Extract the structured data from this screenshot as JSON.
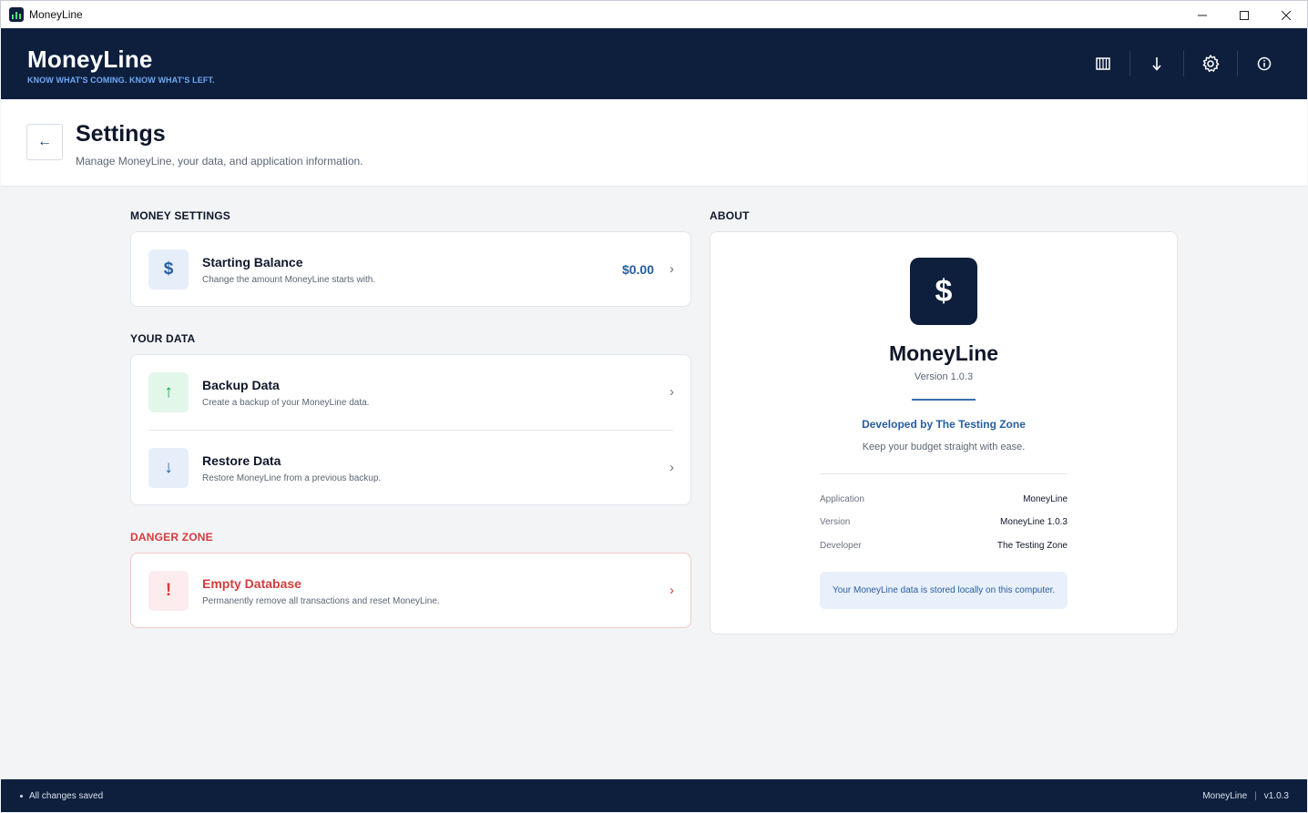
{
  "window": {
    "title": "MoneyLine",
    "controls": {
      "minimize": "—",
      "maximize": "☐",
      "close": "✕"
    }
  },
  "header": {
    "brand": "MoneyLine",
    "tagline": "KNOW WHAT'S COMING. KNOW WHAT'S LEFT.",
    "actions": [
      "calendar-grid-icon",
      "download-icon",
      "gear-icon",
      "info-icon"
    ]
  },
  "page": {
    "back_glyph": "←",
    "title": "Settings",
    "subtitle": "Manage MoneyLine, your data, and application information."
  },
  "money_settings": {
    "label": "MONEY SETTINGS",
    "starting_balance": {
      "icon": "$",
      "title": "Starting Balance",
      "description": "Change the amount MoneyLine starts with.",
      "value": "$0.00",
      "chevron": "›"
    }
  },
  "your_data": {
    "label": "YOUR DATA",
    "backup": {
      "icon": "↑",
      "title": "Backup Data",
      "description": "Create a backup of your MoneyLine data.",
      "chevron": "›"
    },
    "restore": {
      "icon": "↓",
      "title": "Restore Data",
      "description": "Restore MoneyLine from a previous backup.",
      "chevron": "›"
    }
  },
  "danger_zone": {
    "label": "DANGER ZONE",
    "empty_db": {
      "icon": "!",
      "title": "Empty Database",
      "description": "Permanently remove all transactions and reset MoneyLine.",
      "chevron": "›"
    }
  },
  "about": {
    "label": "ABOUT",
    "logo_glyph": "$",
    "name": "MoneyLine",
    "version_line": "Version 1.0.3",
    "developed_by": "Developed by The Testing Zone",
    "tagline": "Keep your budget straight with ease.",
    "details": [
      {
        "key": "Application",
        "value": "MoneyLine"
      },
      {
        "key": "Version",
        "value": "MoneyLine 1.0.3"
      },
      {
        "key": "Developer",
        "value": "The Testing Zone"
      }
    ],
    "note": "Your MoneyLine data is stored locally on this computer."
  },
  "status": {
    "message": "All changes saved",
    "app": "MoneyLine",
    "separator": "|",
    "version": "v1.0.3"
  },
  "colors": {
    "navy": "#0d1f3c",
    "accent_blue": "#275da0",
    "danger_red": "#d33d3d",
    "success_green": "#16a34a",
    "page_bg": "#f3f4f6"
  }
}
